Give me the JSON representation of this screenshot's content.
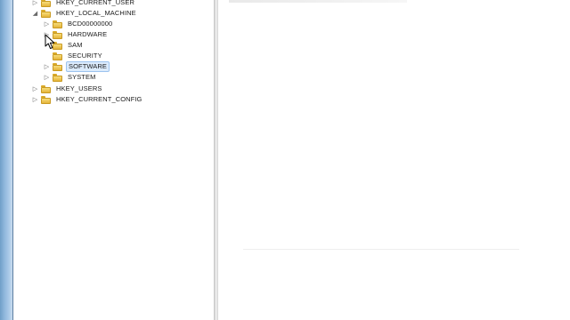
{
  "tree": {
    "nodes": [
      {
        "label": "HKEY_CURRENT_USER",
        "expander": "collapsed",
        "selected": false
      },
      {
        "label": "HKEY_LOCAL_MACHINE",
        "expander": "expanded",
        "selected": false
      },
      {
        "label": "BCD00000000",
        "expander": "collapsed",
        "selected": false
      },
      {
        "label": "HARDWARE",
        "expander": "collapsed",
        "selected": false
      },
      {
        "label": "SAM",
        "expander": "none",
        "selected": false
      },
      {
        "label": "SECURITY",
        "expander": "none",
        "selected": false
      },
      {
        "label": "SOFTWARE",
        "expander": "collapsed",
        "selected": true
      },
      {
        "label": "SYSTEM",
        "expander": "collapsed",
        "selected": false
      },
      {
        "label": "HKEY_USERS",
        "expander": "collapsed",
        "selected": false
      },
      {
        "label": "HKEY_CURRENT_CONFIG",
        "expander": "collapsed",
        "selected": false
      }
    ]
  },
  "icons": {
    "expand": "expand-arrow-icon",
    "collapse": "collapse-arrow-icon",
    "folder": "folder-icon",
    "cursor": "mouse-pointer-icon"
  },
  "colors": {
    "selection_bg": "#dcebfc",
    "selection_border": "#9cc3ee",
    "folder": "#e4b43a",
    "window_edge": "#8fb7dc"
  }
}
